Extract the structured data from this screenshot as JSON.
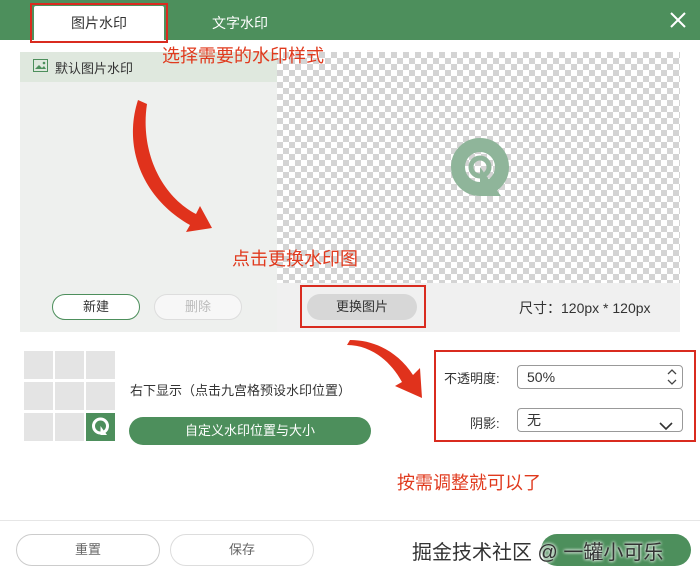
{
  "tabs": [
    {
      "label": "图片水印"
    },
    {
      "label": "文字水印"
    }
  ],
  "left_panel": {
    "list_item_label": "默认图片水印",
    "new_button": "新建",
    "delete_button": "删除"
  },
  "preview": {
    "replace_button": "更换图片",
    "size_text": "尺寸：120px * 120px"
  },
  "position": {
    "description": "右下显示（点击九宫格预设水印位置）",
    "custom_button": "自定义水印位置与大小",
    "selected_cell": "bottom-right"
  },
  "settings": {
    "opacity_label": "不透明度:",
    "opacity_value": "50%",
    "shadow_label": "阴影:",
    "shadow_value": "无"
  },
  "footer": {
    "reset_button": "重置",
    "save_button": "保存"
  },
  "annotations": {
    "select_style": "选择需要的水印样式",
    "click_replace": "点击更换水印图",
    "adjust": "按需调整就可以了"
  },
  "watermark_credit": "掘金技术社区 @ 一罐小可乐",
  "colors": {
    "header_green": "#4d8f5c",
    "annotation_red": "#e03a1e",
    "button_green": "#4d8f5c"
  }
}
